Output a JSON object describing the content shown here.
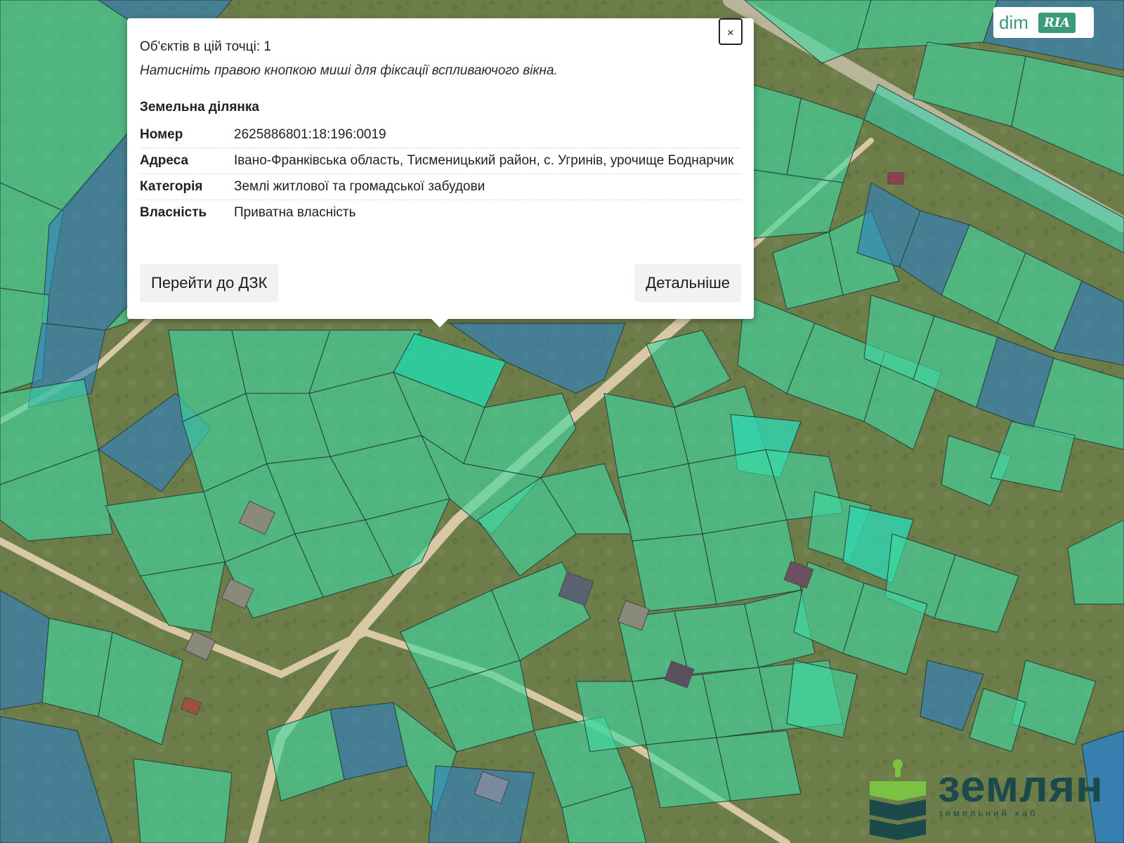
{
  "map": {
    "colors": {
      "satellite_base": "#6f7f4e",
      "parcel_green": "#3fd8a0",
      "parcel_teal": "#2fd6b0",
      "parcel_blue": "#2f7fc0",
      "road": "#d9c8a6",
      "highlight": "#26d6a8"
    }
  },
  "popup": {
    "close_label": "×",
    "objects_count_text": "Об'єктів в цій точці: 1",
    "hint": "Натисніть правою кнопкою миші для фіксації вспливаючого вікна.",
    "section_title": "Земельна ділянка",
    "attributes": [
      {
        "key": "Номер",
        "value": "2625886801:18:196:0019"
      },
      {
        "key": "Адреса",
        "value": "Івано-Франківська область, Тисменицький район, с. Угринів, урочище Боднарчик"
      },
      {
        "key": "Категорія",
        "value": "Землі житлової та громадської забудови"
      },
      {
        "key": "Власність",
        "value": "Приватна власність"
      }
    ],
    "buttons": {
      "go_to_dzk": "Перейти до ДЗК",
      "details": "Детальніше"
    }
  },
  "watermarks": {
    "dimria": {
      "dim": "dim",
      "ria": "RIA"
    },
    "zemlyan": {
      "brand": "землян",
      "subtitle": "земельний хаб",
      "color": "#1c4a4a",
      "accent": "#7cc242"
    }
  }
}
